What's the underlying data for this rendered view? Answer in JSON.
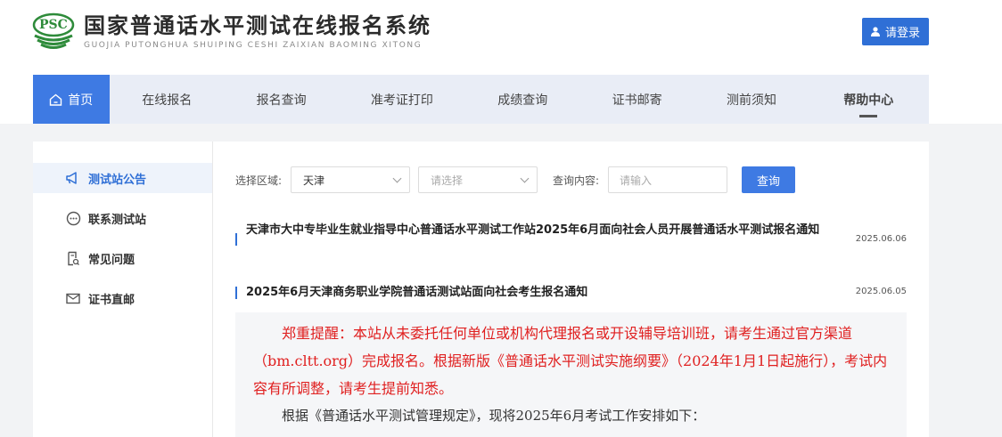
{
  "header": {
    "logo_badge": "PSC",
    "title_cn": "国家普通话水平测试在线报名系统",
    "title_en": "GUOJIA PUTONGHUA SHUIPING CESHI ZAIXIAN BAOMING XITONG",
    "login_label": "请登录"
  },
  "nav": {
    "items": [
      {
        "label": "首页"
      },
      {
        "label": "在线报名"
      },
      {
        "label": "报名查询"
      },
      {
        "label": "准考证打印"
      },
      {
        "label": "成绩查询"
      },
      {
        "label": "证书邮寄"
      },
      {
        "label": "测前须知"
      },
      {
        "label": "帮助中心"
      }
    ]
  },
  "sidebar": {
    "items": [
      {
        "label": "测试站公告",
        "icon": "megaphone-icon"
      },
      {
        "label": "联系测试站",
        "icon": "chat-bubble-icon"
      },
      {
        "label": "常见问题",
        "icon": "document-search-icon"
      },
      {
        "label": "证书直邮",
        "icon": "mail-icon"
      }
    ]
  },
  "filter": {
    "region_label": "选择区域:",
    "region_value": "天津",
    "second_placeholder": "请选择",
    "query_label": "查询内容:",
    "query_placeholder": "请输入",
    "query_button": "查询"
  },
  "notices": [
    {
      "title": "天津市大中专毕业生就业指导中心普通话水平测试工作站2025年6月面向社会人员开展普通话水平测试报名通知",
      "date": "2025.06.06"
    },
    {
      "title": "2025年6月天津商务职业学院普通话测试站面向社会考生报名通知",
      "date": "2025.06.05"
    }
  ],
  "alert": {
    "warning": "郑重提醒：本站从未委托任何单位或机构代理报名或开设辅导培训班，请考生通过官方渠道（bm.cltt.org）完成报名。根据新版《普通话水平测试实施纲要》（2024年1月1日起施行），考试内容有所调整，请考生提前知悉。",
    "body": "根据《普通话水平测试管理规定》，现将2025年6月考试工作安排如下："
  },
  "colors": {
    "primary": "#2f6fd6",
    "nav_bg": "#e9edf6",
    "warning_red": "#e02020"
  }
}
